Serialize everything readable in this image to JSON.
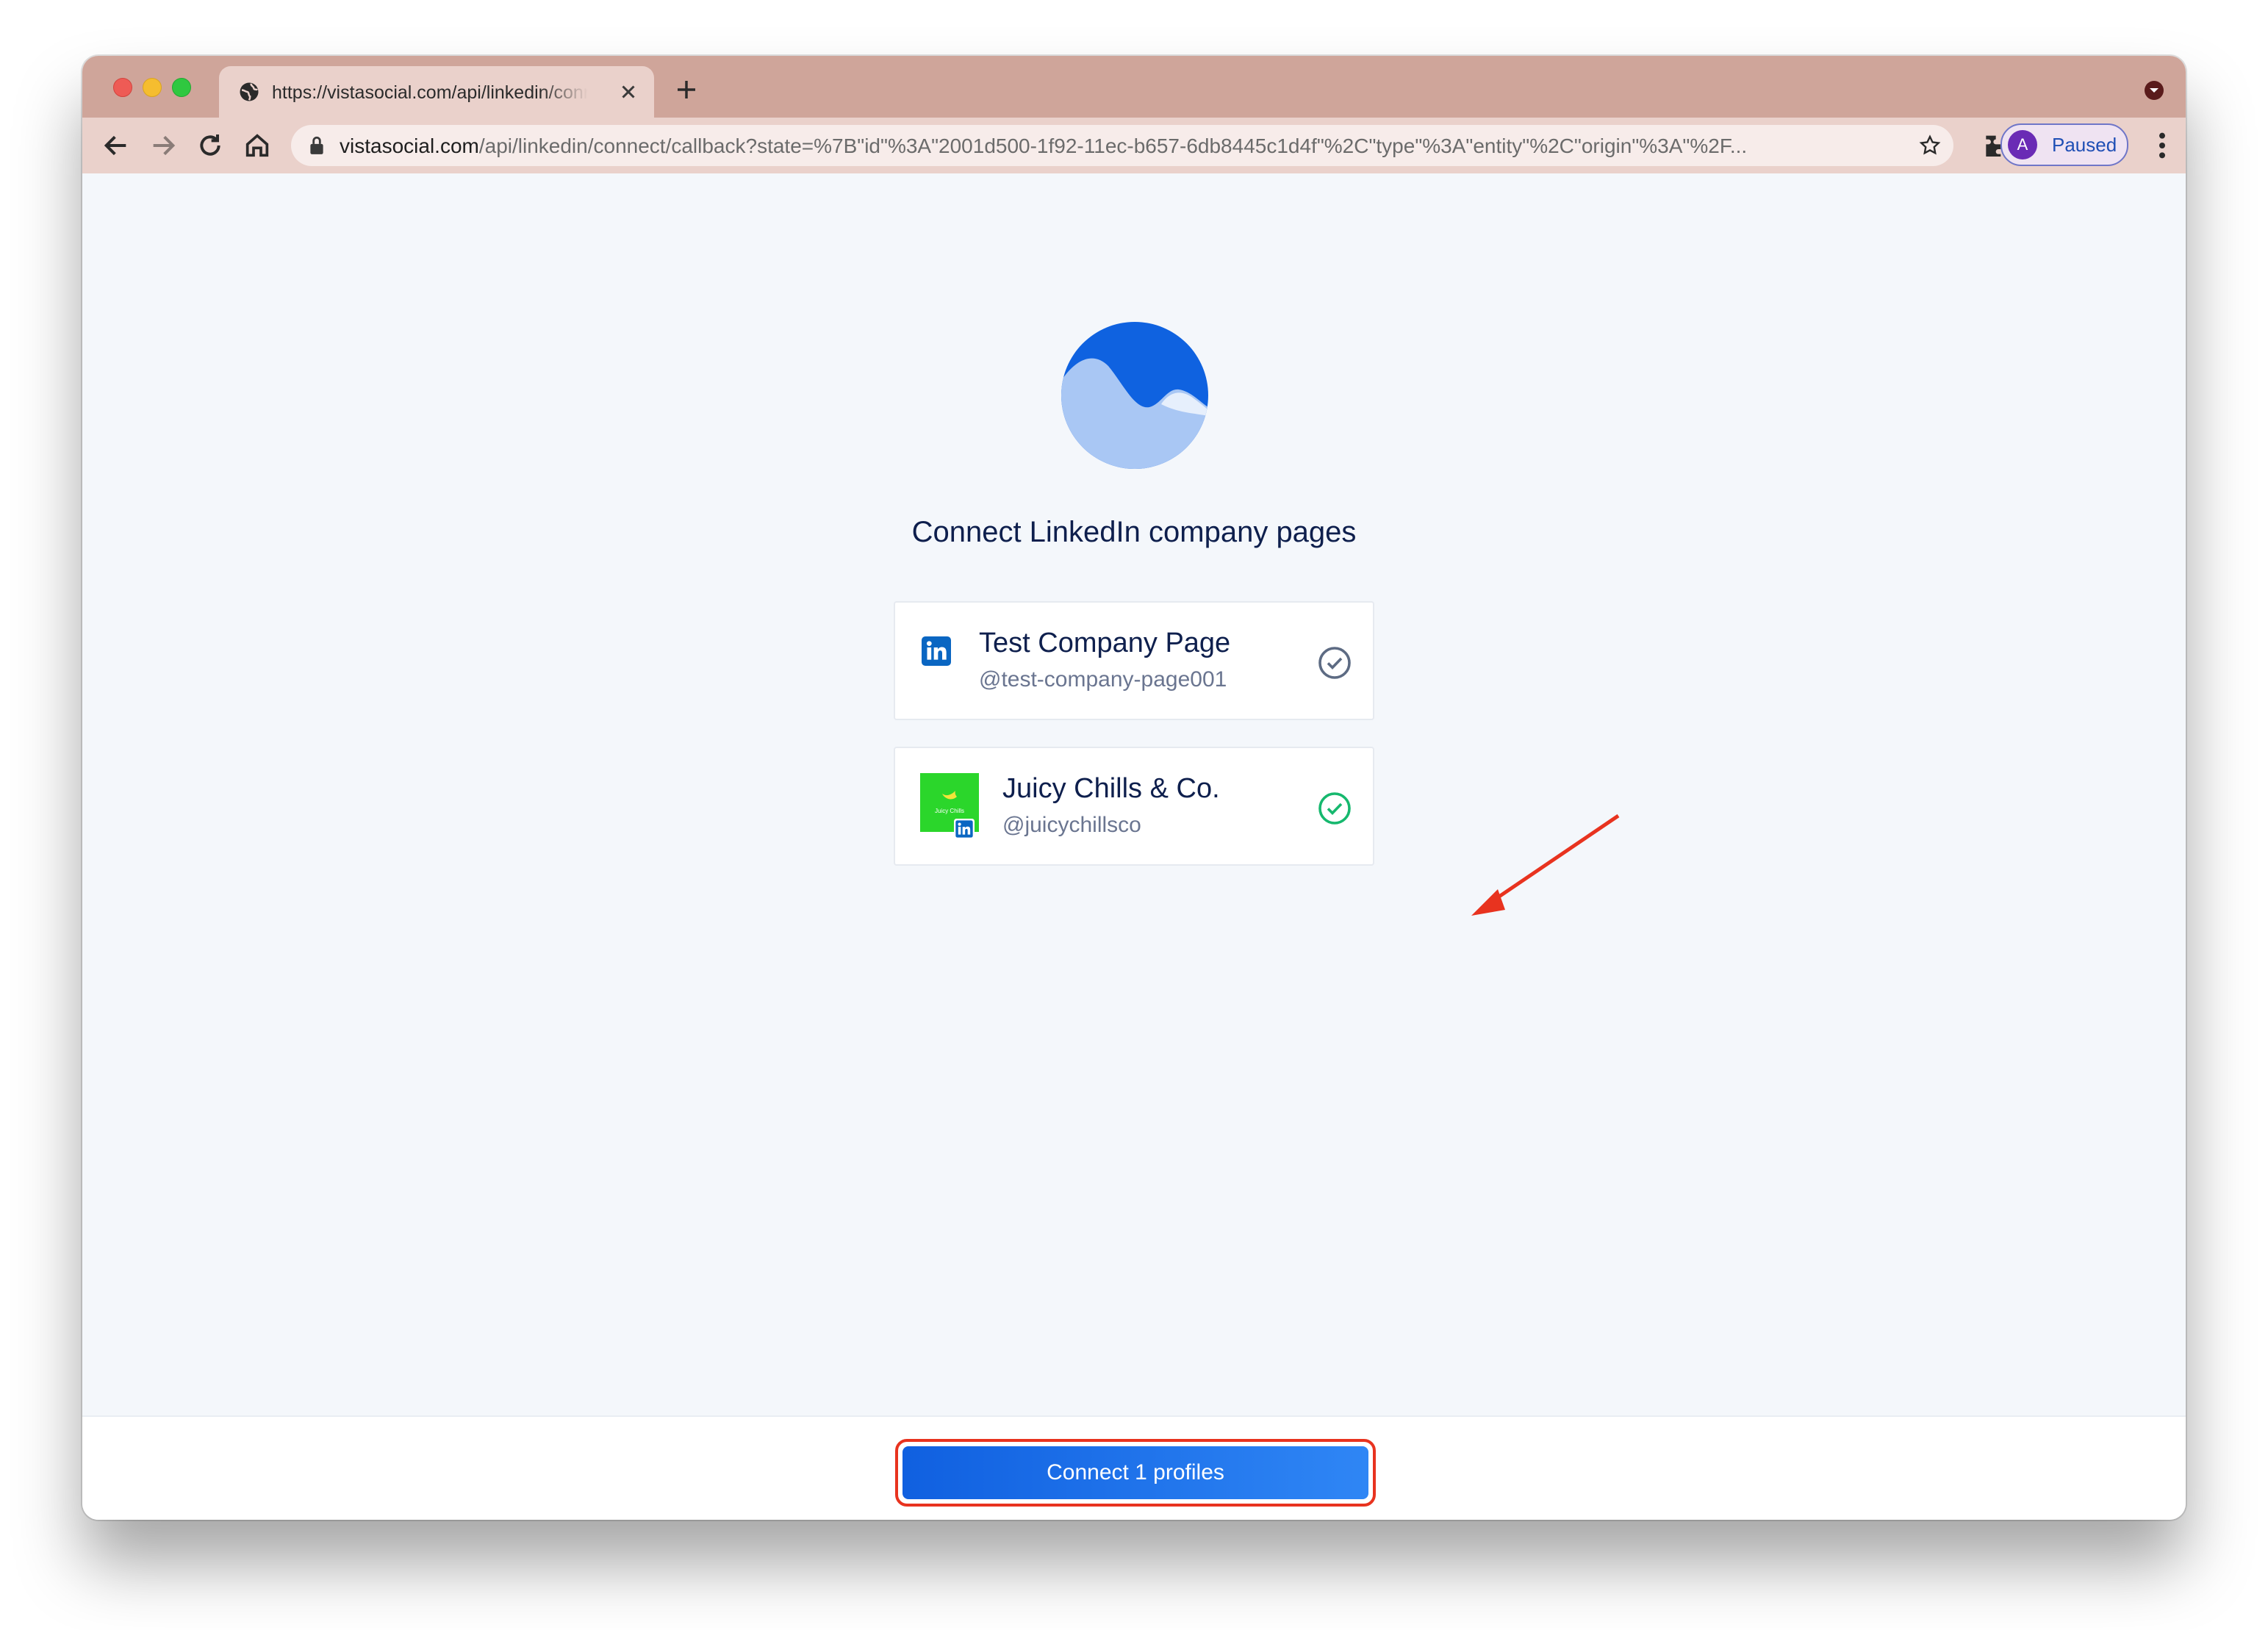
{
  "browser": {
    "tab_title": "https://vistasocial.com/api/linkedin/connect/callback",
    "url_host": "vistasocial.com",
    "url_path": "/api/linkedin/connect/callback?state=%7B\"id\"%3A\"2001d500-1f92-11ec-b657-6db8445c1d4f\"%2C\"type\"%3A\"entity\"%2C\"origin\"%3A\"%2F...",
    "profile_initial": "A",
    "profile_status": "Paused"
  },
  "page": {
    "heading": "Connect LinkedIn company pages",
    "profiles": [
      {
        "name": "Test Company Page",
        "handle": "@test-company-page001",
        "selected": false
      },
      {
        "name": "Juicy Chills & Co.",
        "handle": "@juicychillsco",
        "selected": true
      }
    ],
    "thumb_text": "Juicy Chills",
    "connect_button": "Connect 1 profiles"
  },
  "colors": {
    "brand_blue": "#0e63e3",
    "check_selected": "#16b86e",
    "check_unselected": "#5d6b83",
    "annotation_red": "#e8331f",
    "linkedin_blue": "#0a66c2"
  },
  "icons": [
    "globe-icon",
    "close-icon",
    "plus-icon",
    "back-icon",
    "forward-icon",
    "reload-icon",
    "home-icon",
    "lock-icon",
    "star-icon",
    "extensions-icon",
    "kebab-icon",
    "linkedin-icon",
    "check-circle-icon",
    "arrow-annotation"
  ]
}
